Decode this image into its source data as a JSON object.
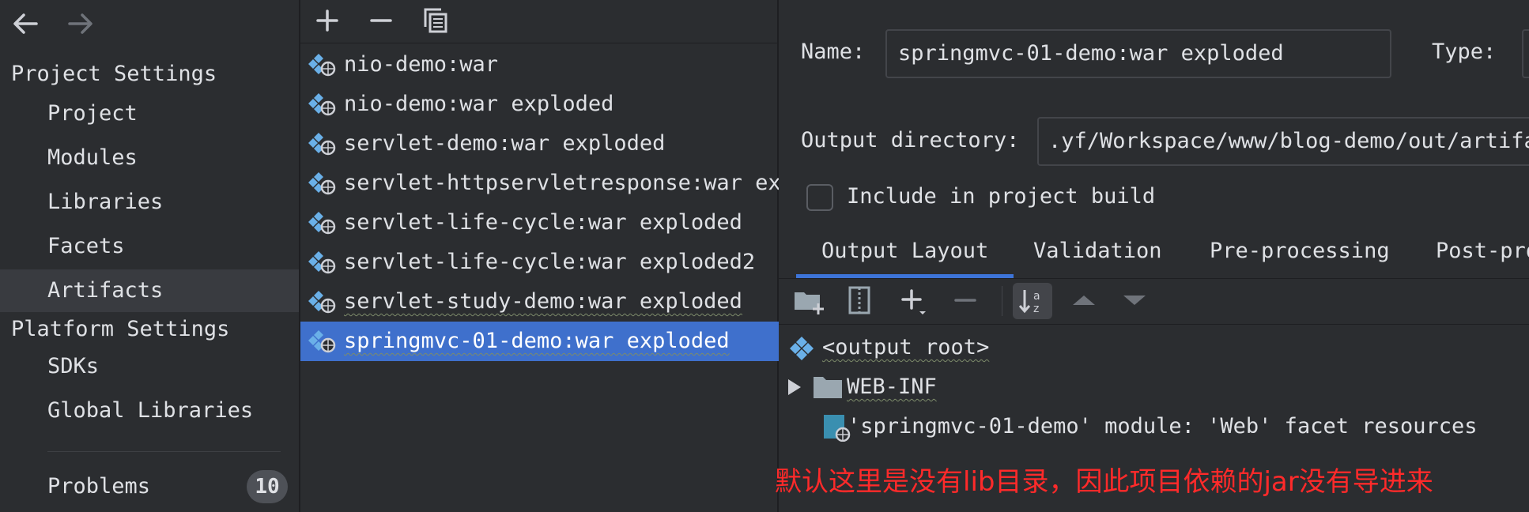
{
  "nav": {
    "section_project": "Project Settings",
    "project_items": [
      "Project",
      "Modules",
      "Libraries",
      "Facets",
      "Artifacts"
    ],
    "section_platform": "Platform Settings",
    "platform_items": [
      "SDKs",
      "Global Libraries"
    ],
    "problems_label": "Problems",
    "problems_count": "10",
    "selected": "Artifacts"
  },
  "artifacts": [
    "nio-demo:war",
    "nio-demo:war exploded",
    "servlet-demo:war exploded",
    "servlet-httpservletresponse:war exp",
    "servlet-life-cycle:war exploded",
    "servlet-life-cycle:war exploded2",
    "servlet-study-demo:war exploded",
    "springmvc-01-demo:war exploded"
  ],
  "details": {
    "name_label": "Name:",
    "name_value": "springmvc-01-demo:war exploded",
    "type_label": "Type:",
    "output_dir_label": "Output directory:",
    "output_dir_value": ".yf/Workspace/www/blog-demo/out/artifac",
    "include_label": "Include in project build",
    "tabs": [
      "Output Layout",
      "Validation",
      "Pre-processing",
      "Post-pro"
    ],
    "tree": {
      "root": "<output root>",
      "webinf": "WEB-INF",
      "facet": "'springmvc-01-demo' module: 'Web' facet resources"
    }
  },
  "annotation": "默认这里是没有lib目录，因此项目依赖的jar没有导进来",
  "colors": {
    "selection": "#3f70cc",
    "tab_accent": "#3d74d8",
    "annotation": "#ff2a2a"
  }
}
